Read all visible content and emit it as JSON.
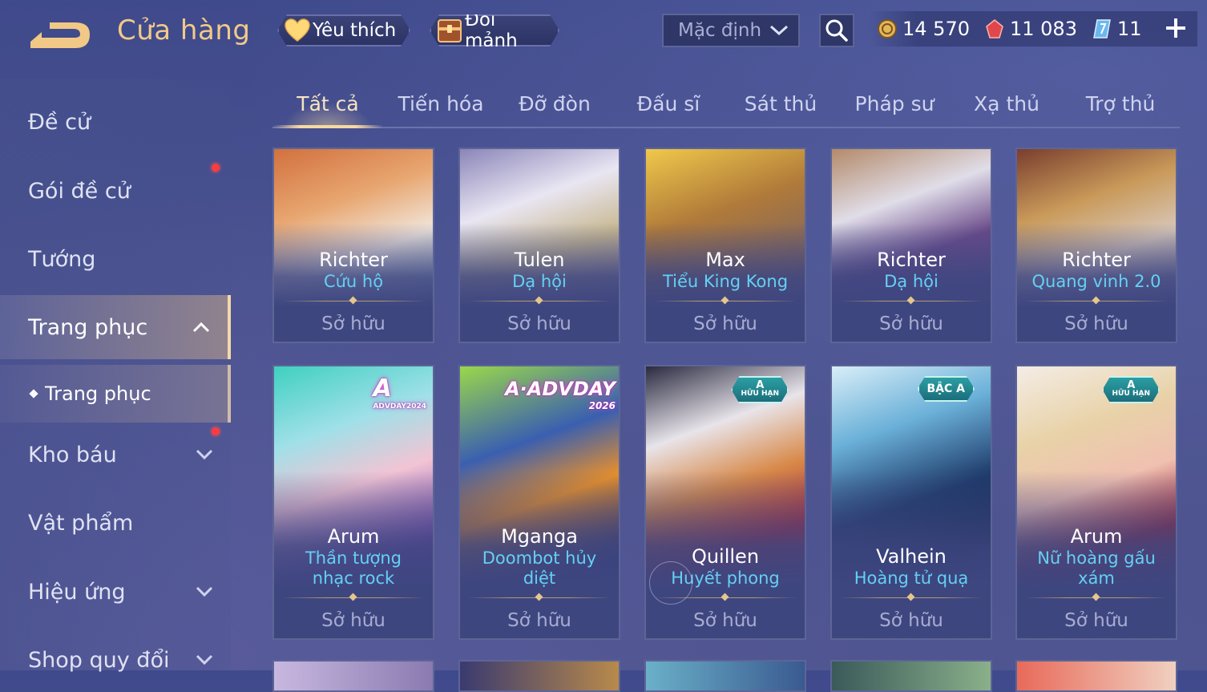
{
  "header": {
    "title": "Cửa hàng",
    "favorites_label": "Yêu thích",
    "exchange_label": "Đổi mảnh",
    "sort": {
      "selected": "Mặc định"
    },
    "currencies": [
      {
        "icon": "gold-coin-icon",
        "value": "14 570"
      },
      {
        "icon": "red-voucher-icon",
        "value": "11 083"
      },
      {
        "icon": "blue-token-icon",
        "value": "11"
      }
    ]
  },
  "sidebar": {
    "items": [
      {
        "label": "Đề cử"
      },
      {
        "label": "Gói đề cử",
        "notification": true
      },
      {
        "label": "Tướng"
      },
      {
        "label": "Trang phục",
        "expanded": true,
        "active": true
      },
      {
        "label": "Kho báu",
        "notification": true
      },
      {
        "label": "Vật phẩm"
      },
      {
        "label": "Hiệu ứng"
      },
      {
        "label": "Shop quy đổi"
      }
    ],
    "sub_item": {
      "label": "Trang phục"
    }
  },
  "tabs": [
    {
      "label": "Tất cả",
      "active": true
    },
    {
      "label": "Tiến hóa"
    },
    {
      "label": "Đỡ đòn"
    },
    {
      "label": "Đấu sĩ"
    },
    {
      "label": "Sát thủ"
    },
    {
      "label": "Pháp sư"
    },
    {
      "label": "Xạ thủ"
    },
    {
      "label": "Trợ thủ"
    }
  ],
  "cards_row1": [
    {
      "hero": "Richter",
      "skin": "Cứu hộ",
      "status": "Sở hữu"
    },
    {
      "hero": "Tulen",
      "skin": "Dạ hội",
      "status": "Sở hữu"
    },
    {
      "hero": "Max",
      "skin": "Tiểu King Kong",
      "status": "Sở hữu"
    },
    {
      "hero": "Richter",
      "skin": "Dạ hội",
      "status": "Sở hữu"
    },
    {
      "hero": "Richter",
      "skin": "Quang vinh 2.0",
      "status": "Sở hữu"
    }
  ],
  "cards_row2": [
    {
      "hero": "Arum",
      "skin": "Thần tượng nhạc rock",
      "status": "Sở hữu",
      "logo": "A",
      "logo_sub": "ADVDAY2024"
    },
    {
      "hero": "Mganga",
      "skin": "Doombot hủy diệt",
      "status": "Sở hữu",
      "logo": "A·ADVDAY",
      "logo_sub": "2026"
    },
    {
      "hero": "Quillen",
      "skin": "Huyết phong",
      "status": "Sở hữu",
      "badge": "A",
      "badge_sub": "HỮU HẠN"
    },
    {
      "hero": "Valhein",
      "skin": "Hoàng tử quạ",
      "status": "Sở hữu",
      "badge": "BẬC A"
    },
    {
      "hero": "Arum",
      "skin": "Nữ hoàng gấu xám",
      "status": "Sở hữu",
      "badge": "A",
      "badge_sub": "HỮU HẠN"
    }
  ],
  "colors": {
    "title_gold": "#f2c988",
    "skin_name_cyan": "#64d0f4",
    "notification_red": "#ff3b3b",
    "background": "#4a528f"
  }
}
